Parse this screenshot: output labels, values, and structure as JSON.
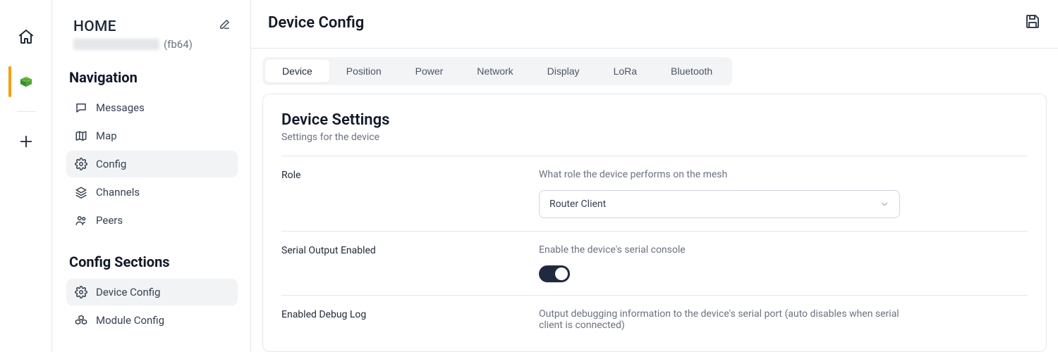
{
  "rail": {
    "home_label": "Home",
    "add_label": "Add"
  },
  "sidebar": {
    "title": "HOME",
    "sub_id": "(fb64)",
    "nav_heading": "Navigation",
    "nav": [
      {
        "label": "Messages"
      },
      {
        "label": "Map"
      },
      {
        "label": "Config"
      },
      {
        "label": "Channels"
      },
      {
        "label": "Peers"
      }
    ],
    "config_heading": "Config Sections",
    "config_sections": [
      {
        "label": "Device Config"
      },
      {
        "label": "Module Config"
      }
    ]
  },
  "main": {
    "title": "Device Config",
    "tabs": [
      {
        "label": "Device"
      },
      {
        "label": "Position"
      },
      {
        "label": "Power"
      },
      {
        "label": "Network"
      },
      {
        "label": "Display"
      },
      {
        "label": "LoRa"
      },
      {
        "label": "Bluetooth"
      }
    ],
    "panel": {
      "title": "Device Settings",
      "subtitle": "Settings for the device",
      "fields": {
        "role": {
          "label": "Role",
          "desc": "What role the device performs on the mesh",
          "value": "Router Client"
        },
        "serial": {
          "label": "Serial Output Enabled",
          "desc": "Enable the device's serial console",
          "value": true
        },
        "debug": {
          "label": "Enabled Debug Log",
          "desc": "Output debugging information to the device's serial port (auto disables when serial client is connected)"
        }
      }
    }
  }
}
